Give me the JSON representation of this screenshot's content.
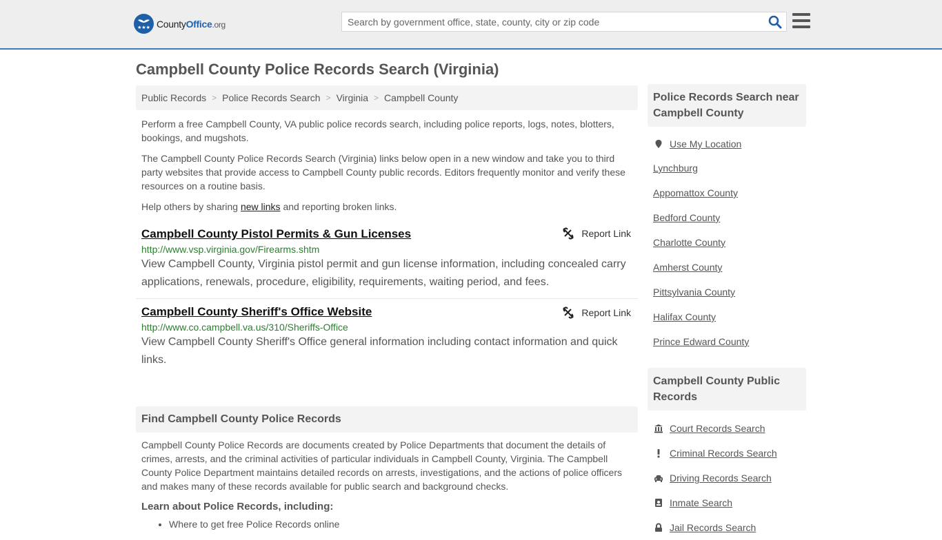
{
  "header": {
    "logo": {
      "county": "County",
      "office": "Office",
      "org": ".org"
    },
    "search_placeholder": "Search by government office, state, county, city or zip code",
    "search_value": ""
  },
  "page_title": "Campbell County Police Records Search (Virginia)",
  "breadcrumb": [
    {
      "label": "Public Records"
    },
    {
      "label": "Police Records Search"
    },
    {
      "label": "Virginia"
    },
    {
      "label": "Campbell County"
    }
  ],
  "intro": {
    "p1": "Perform a free Campbell County, VA public police records search, including police reports, logs, notes, blotters, bookings, and mugshots.",
    "p2": "The Campbell County Police Records Search (Virginia) links below open in a new window and take you to third party websites that provide access to Campbell County public records. Editors frequently monitor and verify these resources on a routine basis.",
    "p3_before": "Help others by sharing ",
    "p3_link": "new links",
    "p3_after": " and reporting broken links."
  },
  "links": [
    {
      "title": "Campbell County Pistol Permits & Gun Licenses",
      "report_label": "Report Link",
      "url": "http://www.vsp.virginia.gov/Firearms.shtm",
      "description": "View Campbell County, Virginia pistol permit and gun license information, including concealed carry applications, renewals, procedure, eligibility, requirements, waiting period, and fees."
    },
    {
      "title": "Campbell County Sheriff's Office Website",
      "report_label": "Report Link",
      "url": "http://www.co.campbell.va.us/310/Sheriffs-Office",
      "description": "View Campbell County Sheriff's Office general information including contact information and quick links."
    }
  ],
  "find_section": {
    "heading": "Find Campbell County Police Records",
    "body": "Campbell County Police Records are documents created by Police Departments that document the details of crimes, arrests, and the criminal activities of particular individuals in Campbell County, Virginia. The Campbell County Police Department maintains detailed records on arrests, investigations, and the actions of police officers and makes many of these records available for public search and background checks.",
    "learn_heading": "Learn about Police Records, including:",
    "learn_items": [
      "Where to get free Police Records online"
    ]
  },
  "sidebar": {
    "nearby_heading": "Police Records Search near Campbell County",
    "use_location": "Use My Location",
    "nearby": [
      "Lynchburg",
      "Appomattox County",
      "Bedford County",
      "Charlotte County",
      "Amherst County",
      "Pittsylvania County",
      "Halifax County",
      "Prince Edward County"
    ],
    "public_heading": "Campbell County Public Records",
    "public_records": [
      {
        "label": "Court Records Search",
        "icon": "courthouse-icon"
      },
      {
        "label": "Criminal Records Search",
        "icon": "exclamation-icon"
      },
      {
        "label": "Driving Records Search",
        "icon": "car-icon"
      },
      {
        "label": "Inmate Search",
        "icon": "id-badge-icon"
      },
      {
        "label": "Jail Records Search",
        "icon": "lock-icon"
      }
    ]
  }
}
